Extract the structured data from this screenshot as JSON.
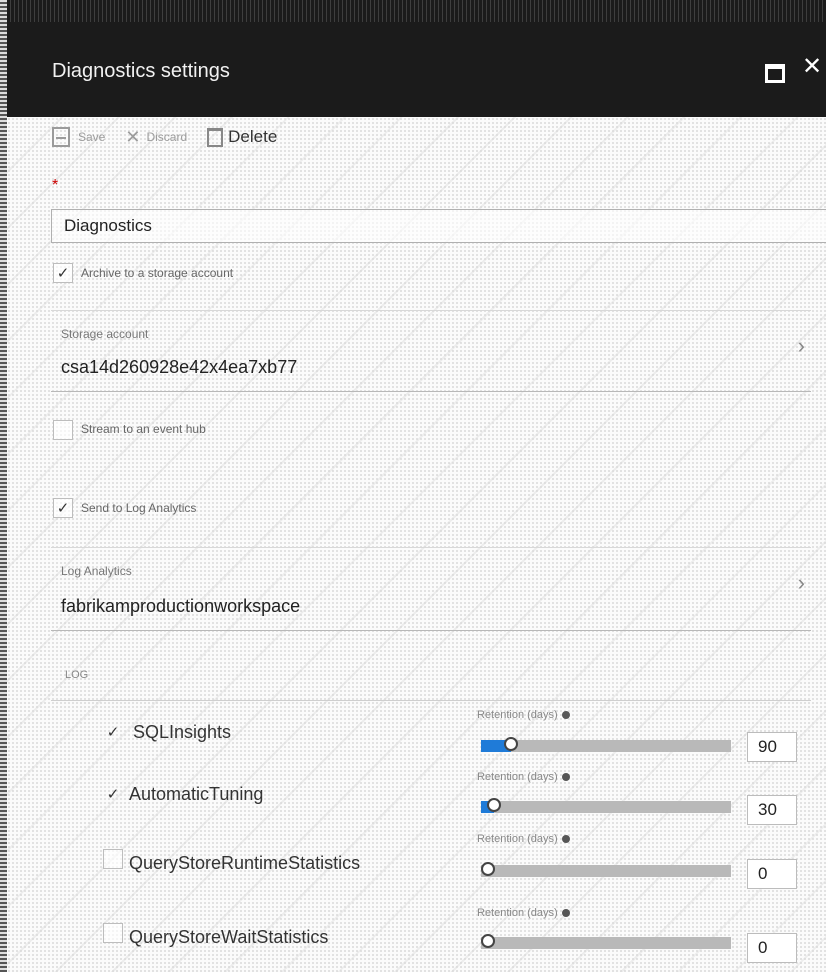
{
  "window": {
    "title": "Diagnostics settings"
  },
  "toolbar": {
    "save_label": "Save",
    "discard_label": "Discard",
    "delete_label": "Delete"
  },
  "form": {
    "required_marker": "*",
    "name_value": "Diagnostics",
    "archive": {
      "label": "Archive to a storage account",
      "checked": true
    },
    "storage": {
      "label": "Storage account",
      "value": "csa14d260928e42x4ea7xb77"
    },
    "event_hub": {
      "label": "Stream to an event hub",
      "checked": false
    },
    "log_analytics_option": {
      "label": "Send to Log Analytics",
      "checked": true
    },
    "log_analytics": {
      "label": "Log Analytics",
      "value": "fabrikamproductionworkspace"
    },
    "log_section_label": "LOG",
    "retention_label": "Retention (days)",
    "log_categories": [
      {
        "name": "SQLInsights",
        "checked": true,
        "retention_days": "90",
        "slider_fraction": 0.12
      },
      {
        "name": "AutomaticTuning",
        "checked": true,
        "retention_days": "30",
        "slider_fraction": 0.05
      },
      {
        "name": "QueryStoreRuntimeStatistics",
        "checked": false,
        "retention_days": "0",
        "slider_fraction": 0
      },
      {
        "name": "QueryStoreWaitStatistics",
        "checked": false,
        "retention_days": "0",
        "slider_fraction": 0
      }
    ]
  },
  "colors": {
    "titlebar": "#1b1b1b",
    "accent": "#1f7bd8",
    "required": "#cc0000"
  },
  "icons": {
    "save": "floppy-disk-icon",
    "discard": "x-icon",
    "delete": "trash-icon",
    "maximize": "maximize-icon",
    "close": "close-icon",
    "chevron": "chevron-right-icon",
    "check": "checkmark-icon",
    "info": "info-icon"
  }
}
